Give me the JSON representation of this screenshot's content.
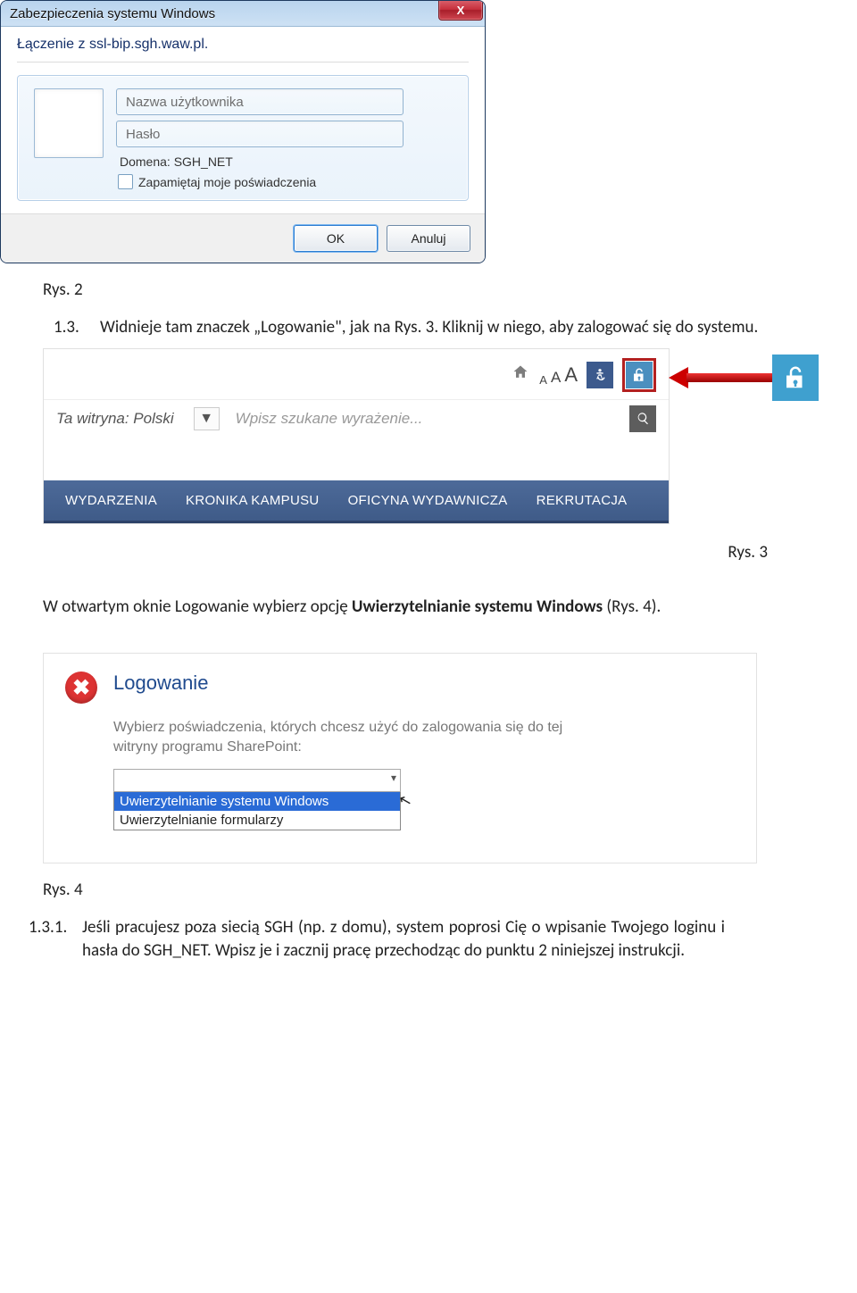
{
  "win7": {
    "title": "Zabezpieczenia systemu Windows",
    "close": "X",
    "subtitle": "Łączenie z ssl-bip.sgh.waw.pl.",
    "username_ph": "Nazwa użytkownika",
    "password_ph": "Hasło",
    "domain": "Domena: SGH_NET",
    "remember": "Zapamiętaj moje poświadczenia",
    "ok": "OK",
    "cancel": "Anuluj"
  },
  "captions": {
    "rys2": "Rys. 2",
    "rys3": "Rys. 3",
    "rys4": "Rys. 4"
  },
  "text": {
    "item13_num": "1.3.",
    "item13": "Widnieje tam znaczek „Logowanie\", jak na Rys. 3. Kliknij w niego, aby zalogować się do systemu.",
    "para2": "W otwartym oknie Logowanie wybierz opcję Uwierzytelnianie systemu Windows (Rys. 4).",
    "para2_bold": "Uwierzytelnianie systemu Windows",
    "item131_num": "1.3.1.",
    "item131": "Jeśli pracujesz poza siecią SGH (np. z domu), system poprosi Cię o wpisanie Twojego loginu i hasła do SGH_NET. Wpisz je i zacznij pracę przechodząc do punktu 2 niniejszej instrukcji."
  },
  "shot2": {
    "aaa": [
      "A",
      "A",
      "A"
    ],
    "lang": "Ta witryna: Polski",
    "search_ph": "Wpisz szukane wyrażenie...",
    "nav": [
      "WYDARZENIA",
      "KRONIKA KAMPUSU",
      "OFICYNA WYDAWNICZA",
      "REKRUTACJA"
    ]
  },
  "shot3": {
    "title": "Logowanie",
    "note": "Wybierz poświadczenia, których chcesz użyć do zalogowania się do tej witryny programu SharePoint:",
    "opt_sel": "Uwierzytelnianie systemu Windows",
    "opt2": "Uwierzytelnianie formularzy"
  }
}
